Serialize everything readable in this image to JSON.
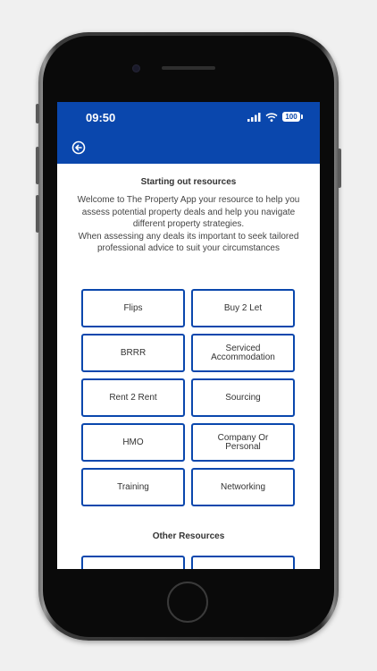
{
  "status_bar": {
    "time": "09:50",
    "battery": "100"
  },
  "header": {
    "back_icon": "back-arrow-circle-icon",
    "color": "#0a47ad"
  },
  "starting": {
    "title": "Starting out resources",
    "intro_line1": "Welcome to The Property App your resource to help you assess potential property deals and help you navigate different property strategies.",
    "intro_line2": "When assessing any deals its important to seek tailored professional advice to suit your circumstances",
    "tiles": [
      "Flips",
      "Buy 2 Let",
      "BRRR",
      "Serviced Accommodation",
      "Rent 2 Rent",
      "Sourcing",
      "HMO",
      "Company Or Personal",
      "Training",
      "Networking"
    ]
  },
  "other": {
    "title": "Other Resources"
  }
}
